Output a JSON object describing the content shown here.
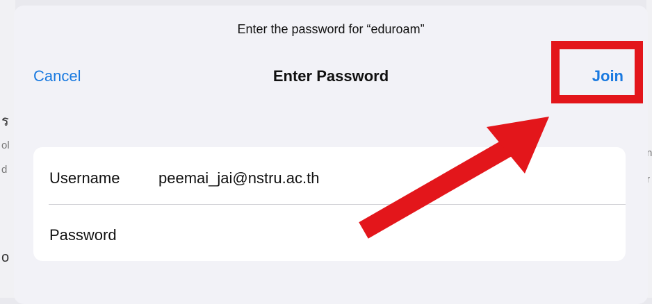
{
  "background": {
    "left_fragments": [
      "ร",
      "ol",
      "d",
      "o"
    ],
    "right_fragments": [
      "n",
      "r"
    ]
  },
  "sheet": {
    "prompt": "Enter the password for “eduroam”",
    "nav": {
      "cancel_label": "Cancel",
      "title": "Enter Password",
      "join_label": "Join"
    },
    "form": {
      "username_label": "Username",
      "username_value": "peemai_jai@nstru.ac.th",
      "password_label": "Password",
      "password_value": ""
    }
  },
  "annotation": {
    "color": "#e3161b",
    "target": "Join"
  },
  "colors": {
    "accent": "#1a7ae0",
    "sheet_bg": "#f2f2f7",
    "card_bg": "#ffffff"
  }
}
